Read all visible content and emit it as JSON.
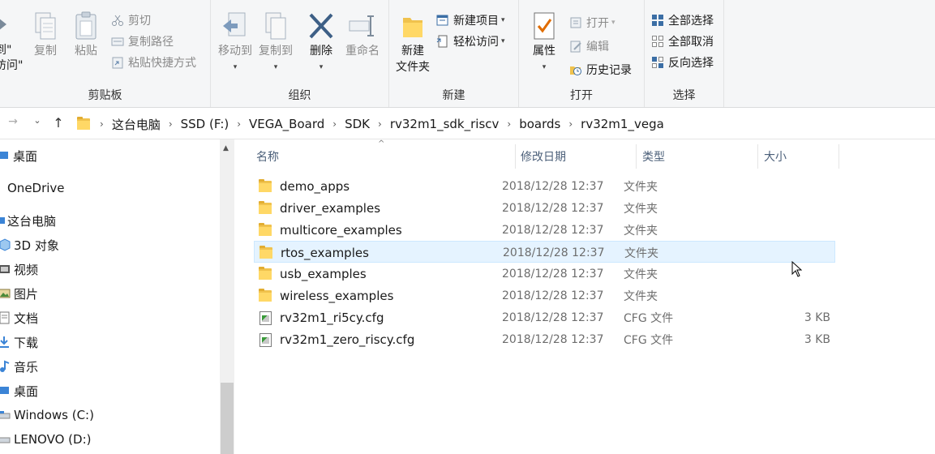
{
  "ribbon": {
    "clipboard": {
      "pin_label": "到\"\n访问\"",
      "copy": "复制",
      "paste": "粘贴",
      "cut": "剪切",
      "copy_path": "复制路径",
      "paste_shortcut": "粘贴快捷方式",
      "group": "剪贴板"
    },
    "organize": {
      "move_to": "移动到",
      "copy_to": "复制到",
      "delete": "删除",
      "rename": "重命名",
      "group": "组织"
    },
    "new": {
      "new_folder_line1": "新建",
      "new_folder_line2": "文件夹",
      "new_item": "新建项目",
      "easy_access": "轻松访问",
      "group": "新建"
    },
    "open": {
      "properties": "属性",
      "open": "打开",
      "edit": "编辑",
      "history": "历史记录",
      "group": "打开"
    },
    "select": {
      "select_all": "全部选择",
      "select_none": "全部取消",
      "invert": "反向选择",
      "group": "选择"
    }
  },
  "address": {
    "crumbs": [
      "这台电脑",
      "SSD (F:)",
      "VEGA_Board",
      "SDK",
      "rv32m1_sdk_riscv",
      "boards",
      "rv32m1_vega"
    ]
  },
  "nav": {
    "items": [
      "桌面",
      "OneDrive",
      "这台电脑",
      "3D 对象",
      "视频",
      "图片",
      "文档",
      "下载",
      "音乐",
      "桌面",
      "Windows (C:)",
      "LENOVO (D:)"
    ]
  },
  "columns": {
    "name": "名称",
    "date": "修改日期",
    "type": "类型",
    "size": "大小"
  },
  "files": [
    {
      "name": "demo_apps",
      "date": "2018/12/28 12:37",
      "type": "文件夹",
      "size": "",
      "icon": "folder-icon"
    },
    {
      "name": "driver_examples",
      "date": "2018/12/28 12:37",
      "type": "文件夹",
      "size": "",
      "icon": "folder-icon"
    },
    {
      "name": "multicore_examples",
      "date": "2018/12/28 12:37",
      "type": "文件夹",
      "size": "",
      "icon": "folder-icon"
    },
    {
      "name": "rtos_examples",
      "date": "2018/12/28 12:37",
      "type": "文件夹",
      "size": "",
      "icon": "folder-icon"
    },
    {
      "name": "usb_examples",
      "date": "2018/12/28 12:37",
      "type": "文件夹",
      "size": "",
      "icon": "folder-icon"
    },
    {
      "name": "wireless_examples",
      "date": "2018/12/28 12:37",
      "type": "文件夹",
      "size": "",
      "icon": "folder-icon"
    },
    {
      "name": "rv32m1_ri5cy.cfg",
      "date": "2018/12/28 12:37",
      "type": "CFG 文件",
      "size": "3 KB",
      "icon": "cfg-file-icon"
    },
    {
      "name": "rv32m1_zero_riscy.cfg",
      "date": "2018/12/28 12:37",
      "type": "CFG 文件",
      "size": "3 KB",
      "icon": "cfg-file-icon"
    }
  ]
}
